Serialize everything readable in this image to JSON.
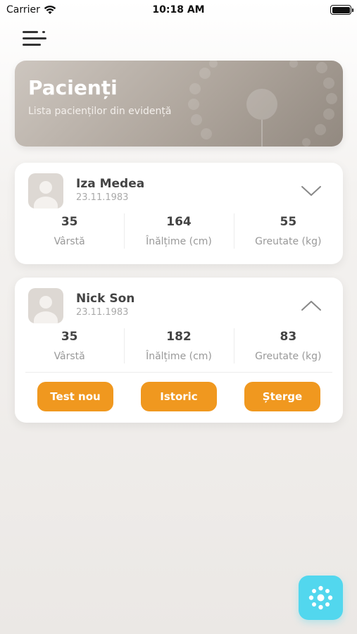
{
  "status_bar": {
    "carrier": "Carrier",
    "time": "10:18 AM"
  },
  "banner": {
    "title": "Pacienți",
    "subtitle": "Lista pacienților din evidență"
  },
  "patients": [
    {
      "name": "Iza Medea",
      "birthdate": "23.11.1983",
      "expanded": false,
      "stats": [
        {
          "value": "35",
          "label": "Vârstă"
        },
        {
          "value": "164",
          "label": "Înălțime (cm)"
        },
        {
          "value": "55",
          "label": "Greutate (kg)"
        }
      ]
    },
    {
      "name": "Nick Son",
      "birthdate": "23.11.1983",
      "expanded": true,
      "stats": [
        {
          "value": "35",
          "label": "Vârstă"
        },
        {
          "value": "182",
          "label": "Înălțime (cm)"
        },
        {
          "value": "83",
          "label": "Greutate (kg)"
        }
      ],
      "actions": [
        {
          "label": "Test nou"
        },
        {
          "label": "Istoric"
        },
        {
          "label": "Șterge"
        }
      ]
    }
  ],
  "icons": {
    "menu": "menu-icon",
    "wifi": "wifi-icon",
    "battery": "battery-icon",
    "expand": "chevron-down-icon",
    "collapse": "chevron-up-icon",
    "avatar": "user-placeholder-icon",
    "fab": "dots-circle-icon"
  },
  "colors": {
    "accent": "#f0981f",
    "fab": "#52d7ee",
    "banner": "#aea59c"
  }
}
